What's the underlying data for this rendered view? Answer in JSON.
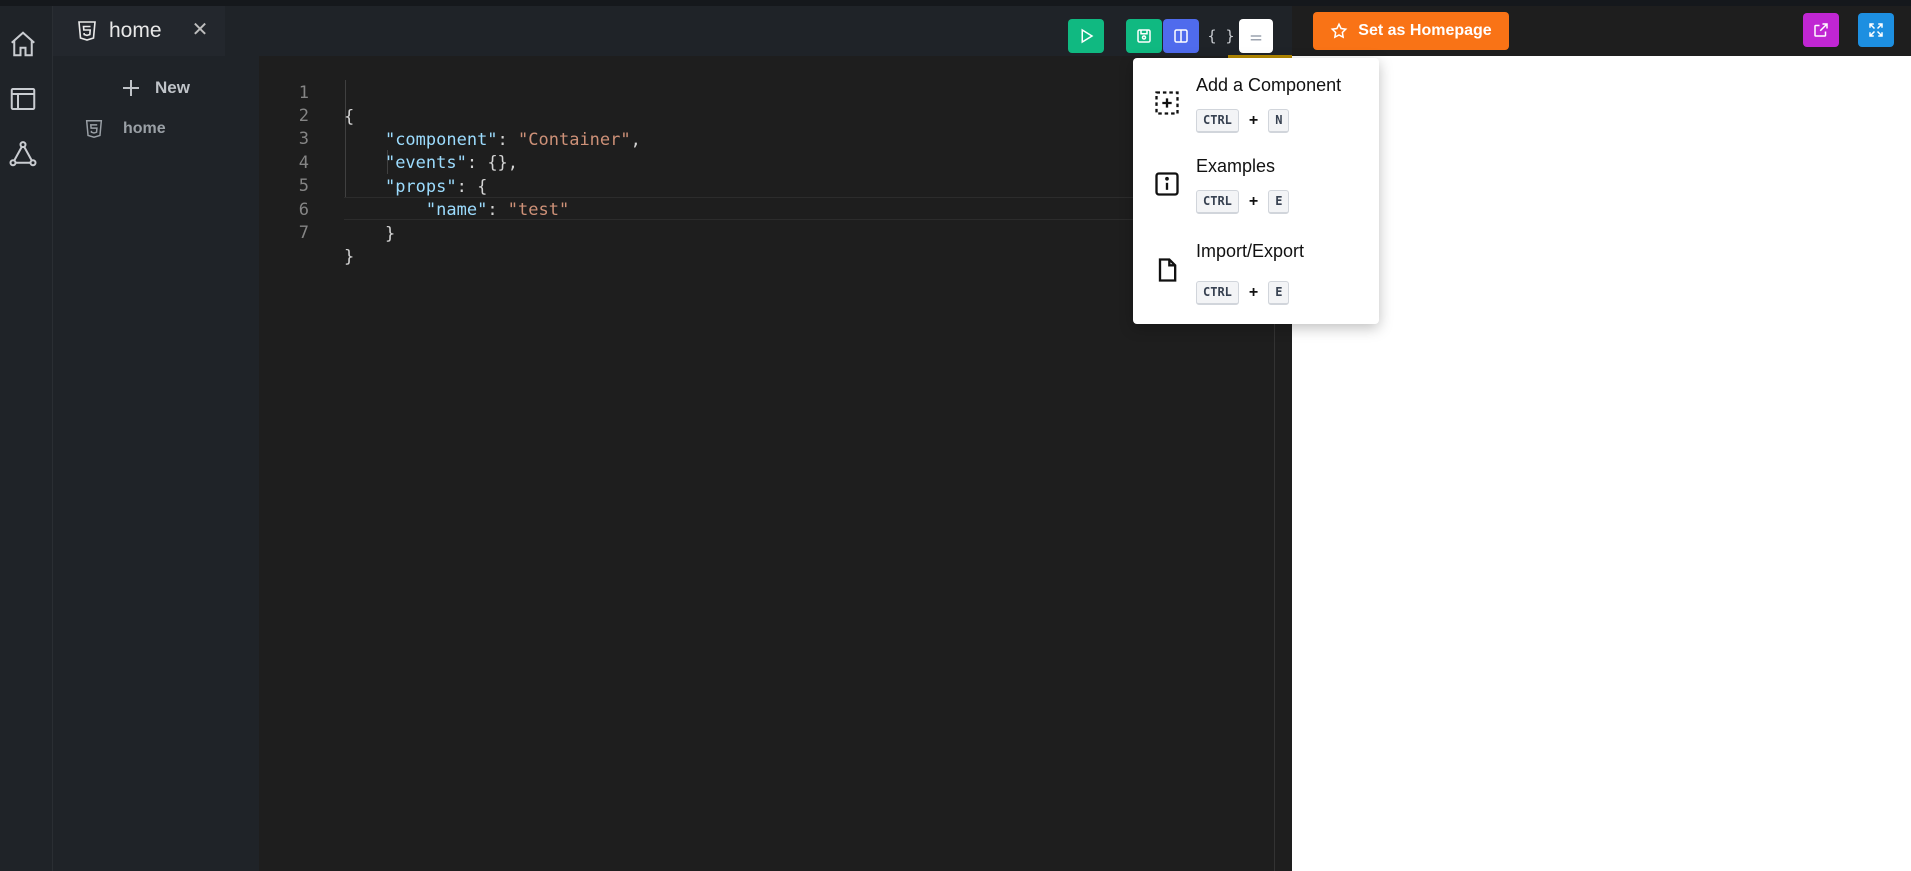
{
  "tab": {
    "label": "home",
    "close": "✕"
  },
  "toolbar": {
    "run": "play-icon",
    "save": "save-icon",
    "split": "columns-icon",
    "json_toggle": "{ }",
    "menu": "menu-icon"
  },
  "homepage_button": {
    "label": "Set as Homepage"
  },
  "file_tree": {
    "new_label": "New",
    "items": [
      {
        "label": "home"
      }
    ]
  },
  "editor": {
    "line_numbers": [
      "1",
      "2",
      "3",
      "4",
      "5",
      "6",
      "7"
    ],
    "lines": {
      "l1": "{",
      "l2_key": "\"component\"",
      "l2_val": "\"Container\"",
      "l3_key": "\"events\"",
      "l3_rest": ": {},",
      "l4_key": "\"props\"",
      "l4_rest": ": {",
      "l5_key": "\"name\"",
      "l5_val": "\"test\"",
      "l6": "}",
      "l7": "}"
    }
  },
  "menu": {
    "items": [
      {
        "label": "Add a Component",
        "keys": [
          "CTRL",
          "N"
        ]
      },
      {
        "label": "Examples",
        "keys": [
          "CTRL",
          "E"
        ]
      },
      {
        "label": "Import/Export",
        "keys": [
          "CTRL",
          "E"
        ]
      }
    ]
  },
  "colors": {
    "run": "#10b981",
    "save": "#10b981",
    "split": "#4f6bed",
    "homepage": "#f97316",
    "open_external": "#c026d3",
    "fullscreen": "#1d8fe1"
  }
}
